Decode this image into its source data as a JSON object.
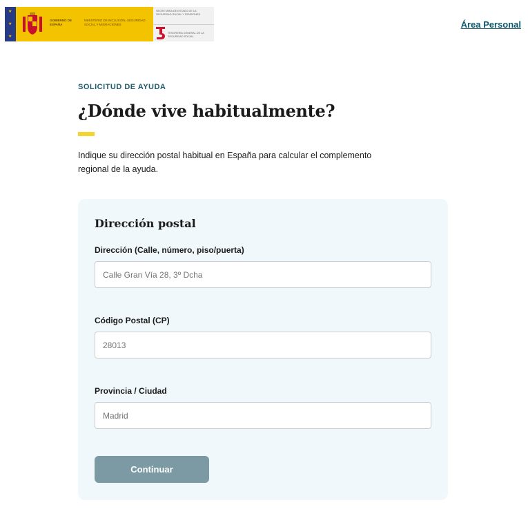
{
  "header": {
    "gov_logo": {
      "gobierno": "GOBIERNO DE ESPAÑA",
      "ministerio": "MINISTERIO DE INCLUSIÓN, SEGURIDAD SOCIAL Y MIGRACIONES"
    },
    "ss_logo": {
      "secretaria": "SECRETARÍA DE ESTADO DE LA SEGURIDAD SOCIAL Y PENSIONES",
      "tgss": "TESORERÍA GENERAL DE LA SEGURIDAD SOCIAL"
    },
    "area_personal": "Área Personal"
  },
  "main": {
    "eyebrow": "SOLICITUD DE AYUDA",
    "title": "¿Dónde vive habitualmente?",
    "intro": "Indique su dirección postal habitual en España para calcular el complemento regional de la ayuda."
  },
  "form": {
    "title": "Dirección postal",
    "address": {
      "label": "Dirección (Calle, número, piso/puerta)",
      "placeholder": "Calle Gran Vía 28, 3º Dcha"
    },
    "postal_code": {
      "label": "Código Postal (CP)",
      "placeholder": "28013"
    },
    "province": {
      "label": "Provincia / Ciudad",
      "placeholder": "Madrid"
    },
    "submit_label": "Continuar"
  },
  "colors": {
    "accent_yellow": "#f2d530",
    "brand_teal": "#1e5a6b",
    "button_disabled": "#7b9aa4",
    "card_bg": "#f1f8fb"
  }
}
